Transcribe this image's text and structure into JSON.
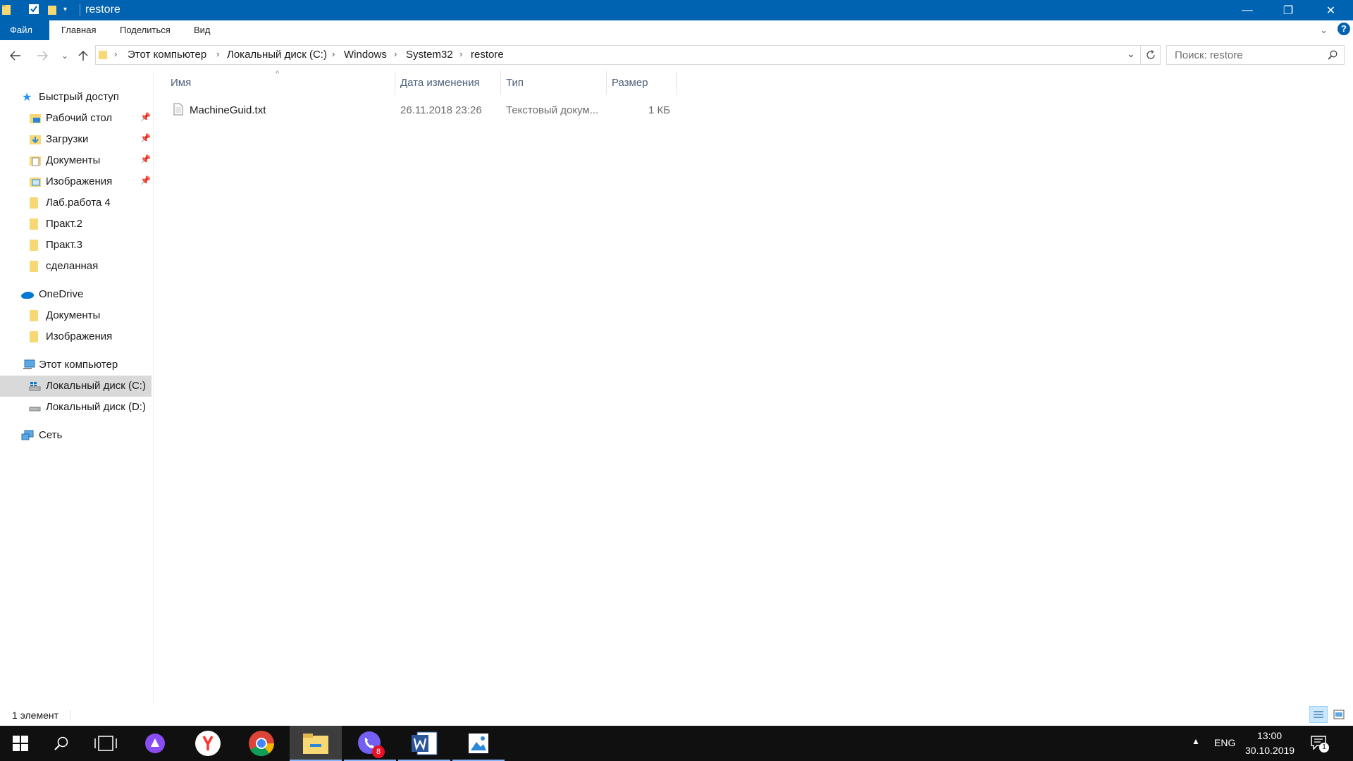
{
  "window": {
    "title": "restore",
    "minimize": "—",
    "restore": "❐",
    "close": "✕"
  },
  "ribbon": {
    "tabs": [
      {
        "label": "Файл",
        "active": true
      },
      {
        "label": "Главная",
        "active": false
      },
      {
        "label": "Поделиться",
        "active": false
      },
      {
        "label": "Вид",
        "active": false
      }
    ]
  },
  "address": {
    "crumbs": [
      "Этот компьютер",
      "Локальный диск (C:)",
      "Windows",
      "System32",
      "restore"
    ],
    "search_placeholder": "Поиск: restore"
  },
  "nav": {
    "quick_access": "Быстрый доступ",
    "quick_items": [
      "Рабочий стол",
      "Загрузки",
      "Документы",
      "Изображения",
      "Лаб.работа 4",
      "Практ.2",
      "Практ.3",
      "сделанная"
    ],
    "onedrive": "OneDrive",
    "onedrive_items": [
      "Документы",
      "Изображения"
    ],
    "this_pc": "Этот компьютер",
    "drives": [
      "Локальный диск (C:)",
      "Локальный диск (D:)"
    ],
    "network": "Сеть"
  },
  "table": {
    "columns": [
      "Имя",
      "Дата изменения",
      "Тип",
      "Размер"
    ],
    "rows": [
      {
        "name": "MachineGuid.txt",
        "modified": "26.11.2018 23:26",
        "type": "Текстовый докум...",
        "size": "1 КБ"
      }
    ]
  },
  "status": {
    "count": "1 элемент"
  },
  "taskbar": {
    "language": "ENG",
    "time": "13:00",
    "date": "30.10.2019",
    "viber_badge": "8",
    "notification_badge": "1"
  },
  "colors": {
    "accent": "#0063b1",
    "taskbar": "#101010",
    "folder": "#f8d775"
  }
}
